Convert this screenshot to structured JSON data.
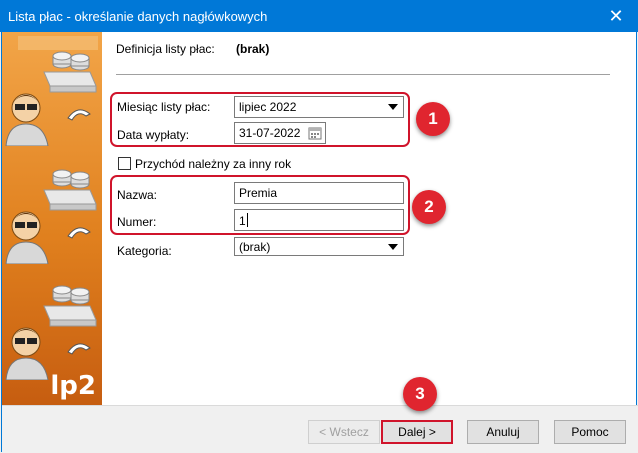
{
  "window": {
    "title": "Lista płac - określanie danych nagłówkowych"
  },
  "header": {
    "definition_label": "Definicja listy płac:",
    "definition_value": "(brak)"
  },
  "form": {
    "month_label": "Miesiąc listy płac:",
    "month_value": "lipiec 2022",
    "payout_date_label": "Data wypłaty:",
    "payout_date_value": "31-07-2022",
    "other_year_label": "Przychód należny za inny rok",
    "other_year_checked": false,
    "name_label": "Nazwa:",
    "name_value": "Premia",
    "number_label": "Numer:",
    "number_value": "1",
    "category_label": "Kategoria:",
    "category_value": "(brak)"
  },
  "sidebar": {
    "logo_text": "lp2"
  },
  "annotations": [
    "1",
    "2",
    "3"
  ],
  "buttons": {
    "back": "< Wstecz",
    "next": "Dalej >",
    "cancel": "Anuluj",
    "help": "Pomoc"
  },
  "colors": {
    "titlebar": "#0078d7",
    "sidebar": "#e0801e",
    "highlight": "#d0142b"
  }
}
